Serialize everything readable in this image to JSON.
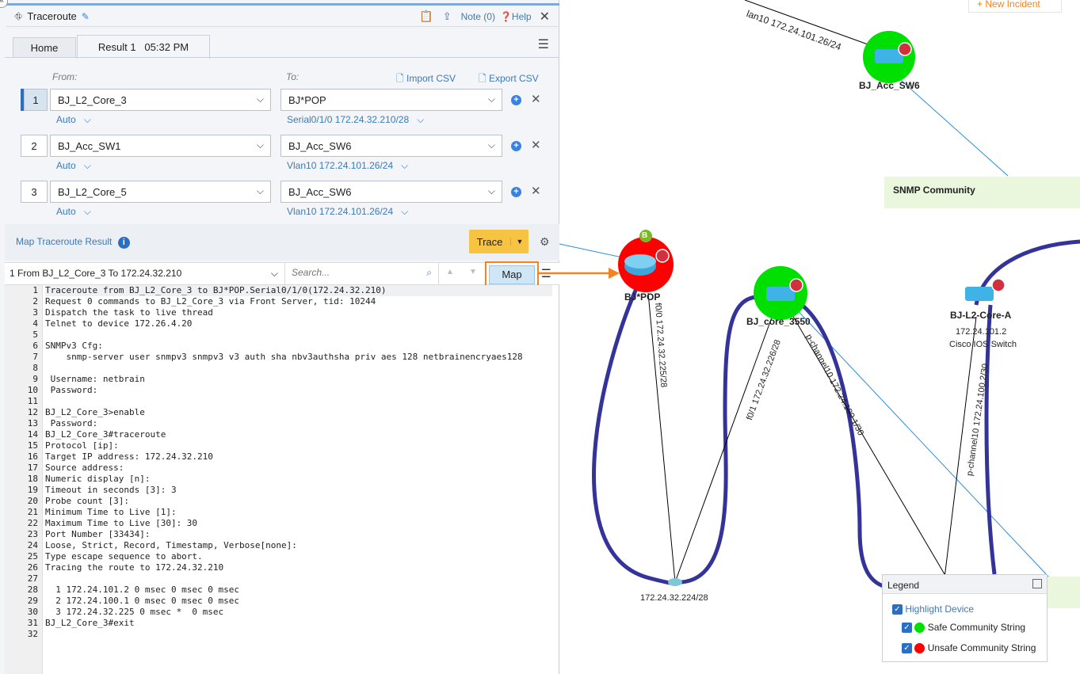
{
  "panel": {
    "title": "Traceroute",
    "note": "Note (0)",
    "help": "Help",
    "tabs": [
      {
        "label": "Home"
      },
      {
        "label": "Result 1   05:32 PM"
      }
    ],
    "from_label": "From:",
    "to_label": "To:",
    "import_csv": "Import CSV",
    "export_csv": "Export CSV",
    "rows": [
      {
        "num": "1",
        "from": "BJ_L2_Core_3",
        "from_sub": "Auto",
        "to": "BJ*POP",
        "to_sub": "Serial0/1/0 172.24.32.210/28"
      },
      {
        "num": "2",
        "from": "BJ_Acc_SW1",
        "from_sub": "Auto",
        "to": "BJ_Acc_SW6",
        "to_sub": "Vlan10 172.24.101.26/24"
      },
      {
        "num": "3",
        "from": "BJ_L2_Core_5",
        "from_sub": "Auto",
        "to": "BJ_Acc_SW6",
        "to_sub": "Vlan10 172.24.101.26/24"
      }
    ],
    "map_result": "Map Traceroute Result",
    "trace": "Trace",
    "result_select": "1 From BJ_L2_Core_3 To 172.24.32.210",
    "search_placeholder": "Search...",
    "map": "Map"
  },
  "code_lines": [
    "Traceroute from BJ_L2_Core_3 to BJ*POP.Serial0/1/0(172.24.32.210)",
    "Request 0 commands to BJ_L2_Core_3 via Front Server, tid: 10244",
    "Dispatch the task to live thread",
    "Telnet to device 172.26.4.20",
    "",
    "SNMPv3 Cfg:",
    "    snmp-server user snmpv3 snmpv3 v3 auth sha nbv3authsha priv aes 128 netbrainencryaes128",
    "",
    " Username: netbrain",
    " Password:",
    "",
    "BJ_L2_Core_3>enable",
    " Password:",
    "BJ_L2_Core_3#traceroute",
    "Protocol [ip]:",
    "Target IP address: 172.24.32.210",
    "Source address:",
    "Numeric display [n]:",
    "Timeout in seconds [3]: 3",
    "Probe count [3]:",
    "Minimum Time to Live [1]:",
    "Maximum Time to Live [30]: 30",
    "Port Number [33434]:",
    "Loose, Strict, Record, Timestamp, Verbose[none]:",
    "Type escape sequence to abort.",
    "Tracing the route to 172.24.32.210",
    "",
    "  1 172.24.101.2 0 msec 0 msec 0 msec",
    "  2 172.24.100.1 0 msec 0 msec 0 msec",
    "  3 172.24.32.225 0 msec *  0 msec",
    "BJ_L2_Core_3#exit",
    ""
  ],
  "map": {
    "new_incident": "+ New Incident",
    "top_link": "lan10 172.24.101.26/24",
    "nodes": {
      "acc_sw6": "BJ_Acc_SW6",
      "pop": "BJ*POP",
      "pop_badge": "B",
      "core3550": "BJ_core_3550",
      "l2corea": "BJ-L2-Core-A",
      "l2corea_ip": "172.24.101.2",
      "l2corea_type": "Cisco IOS Switch",
      "subnet": "172.24.32.224/28"
    },
    "links": {
      "pop_f0": "f0/0 172.24.32.225/28",
      "core_f01": "f0/1 172.24.32.226/28",
      "core_pch": "p-channel10 172.24.100.1/30",
      "corea_pch": "p-channel10 172.24.100.2/30"
    },
    "snmp_note": "SNMP Community",
    "legend": {
      "title": "Legend",
      "highlight": "Highlight Device",
      "safe": "Safe Community String",
      "unsafe": "Unsafe Community String"
    },
    "colors": {
      "safe": "#00e000",
      "unsafe": "#ff0000",
      "link": "#33339a",
      "accent": "#f58220"
    }
  }
}
